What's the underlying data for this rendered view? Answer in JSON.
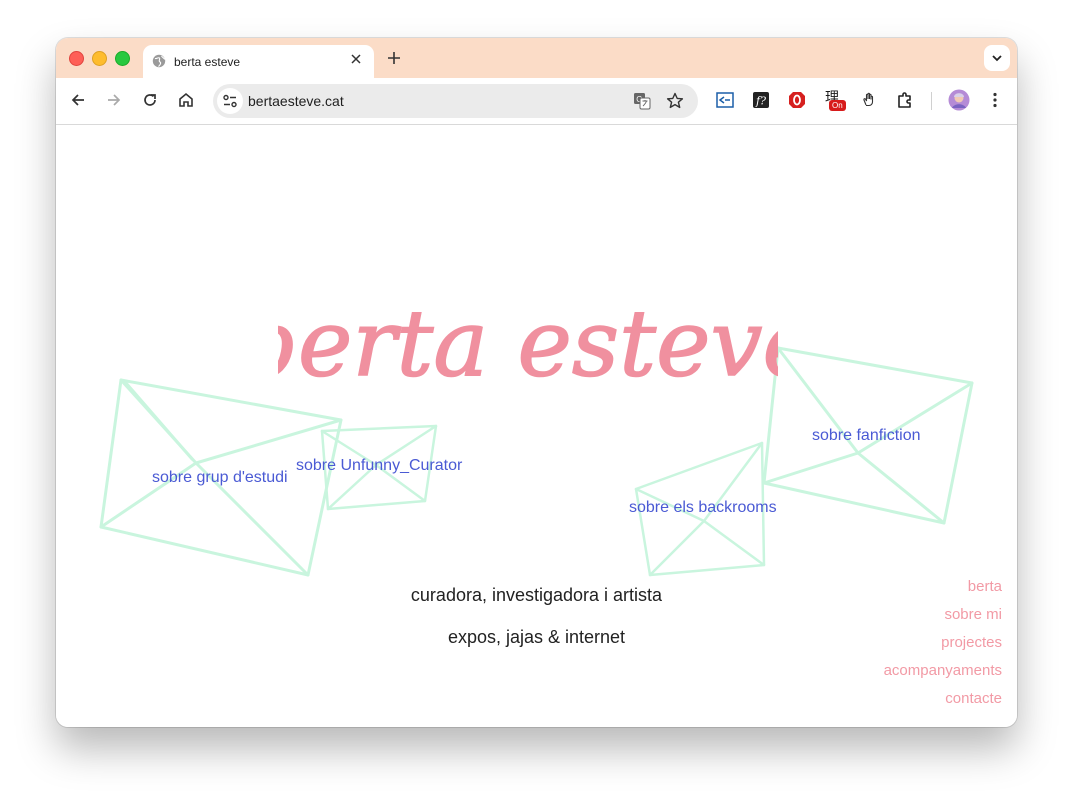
{
  "browser": {
    "tab": {
      "title": "berta esteve"
    },
    "omnibox": {
      "url": "bertaesteve.cat"
    },
    "extension_badge": "On"
  },
  "site": {
    "logo_text": "berta esteve",
    "envelopes": [
      {
        "label": "sobre grup d'estudi"
      },
      {
        "label": "sobre Unfunny_Curator"
      },
      {
        "label": "sobre els backrooms"
      },
      {
        "label": "sobre fanfiction"
      }
    ],
    "tagline_1": "curadora, investigadora i artista",
    "tagline_2": "expos, jajas & internet",
    "nav": [
      "berta",
      "sobre mi",
      "projectes",
      "acompanyaments",
      "contacte"
    ]
  },
  "colors": {
    "tabbar": "#fbdcc7",
    "logo": "#f0909f",
    "link": "#4a5ad4",
    "nav": "#f29aa5",
    "envelope_stroke": "#c9f5de"
  },
  "icons": [
    "globe-icon",
    "close-icon",
    "plus-icon",
    "chevron-down-icon",
    "back-icon",
    "forward-icon",
    "reload-icon",
    "home-icon",
    "site-settings-icon",
    "translate-icon",
    "star-icon",
    "reader-icon",
    "font-icon",
    "opera-icon",
    "extension-badge-icon",
    "hand-icon",
    "puzzle-icon",
    "avatar",
    "menu-dots-icon"
  ]
}
